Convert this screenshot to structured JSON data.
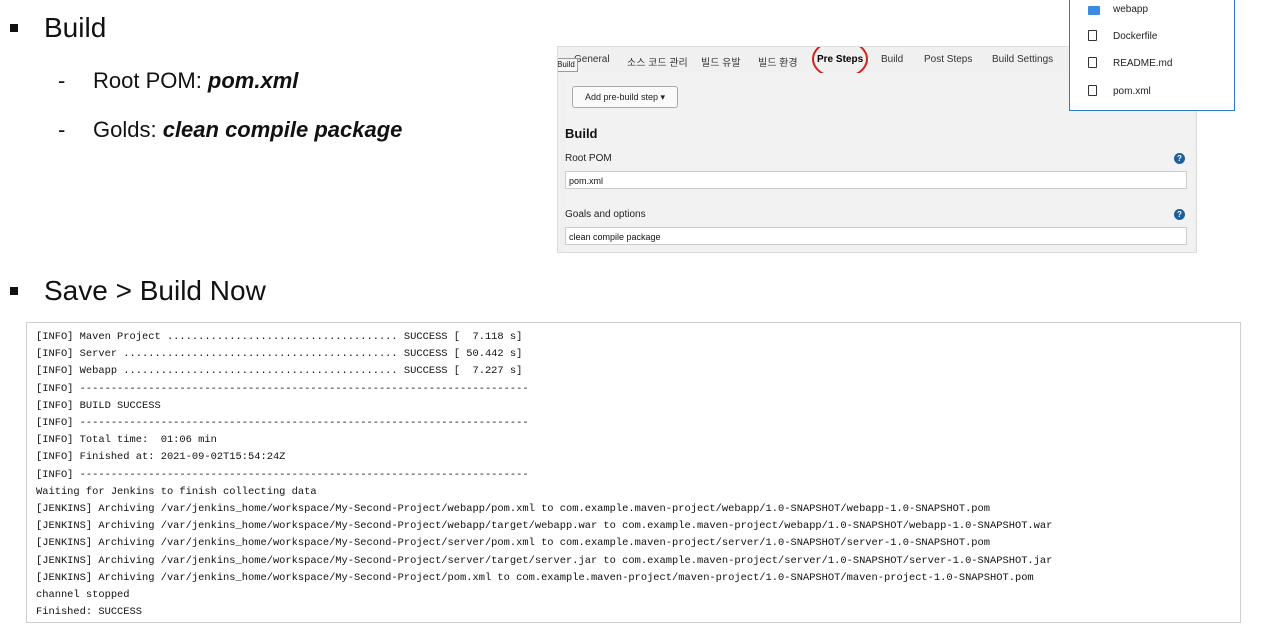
{
  "build": {
    "heading": "Build",
    "root_pom_label": "Root POM: ",
    "root_pom_value": "pom.xml",
    "goals_label": "Golds: ",
    "goals_value": "clean compile package"
  },
  "save_heading": "Save > Build Now",
  "config_panel": {
    "tabs": [
      "General",
      "소스 코드 관리",
      "빌드 유발",
      "빌드 환경",
      "Pre Steps",
      "Build",
      "Post Steps",
      "Build Settings"
    ],
    "active_tab": "Pre Steps",
    "tooltip": "Build",
    "add_step_button": "Add pre-build step ▾",
    "section_title": "Build",
    "root_pom_label": "Root POM",
    "root_pom_value": "pom.xml",
    "goals_label": "Goals and options",
    "goals_value": "clean compile package",
    "help_icon": "?"
  },
  "file_browser": {
    "items": [
      {
        "name": "webapp",
        "type": "folder"
      },
      {
        "name": "Dockerfile",
        "type": "file"
      },
      {
        "name": "README.md",
        "type": "file"
      },
      {
        "name": "pom.xml",
        "type": "file"
      }
    ]
  },
  "console": {
    "lines": [
      "[INFO] Maven Project ..................................... SUCCESS [  7.118 s]",
      "[INFO] Server ............................................ SUCCESS [ 50.442 s]",
      "[INFO] Webapp ............................................ SUCCESS [  7.227 s]",
      "[INFO] ------------------------------------------------------------------------",
      "[INFO] BUILD SUCCESS",
      "[INFO] ------------------------------------------------------------------------",
      "[INFO] Total time:  01:06 min",
      "[INFO] Finished at: 2021-09-02T15:54:24Z",
      "[INFO] ------------------------------------------------------------------------",
      "Waiting for Jenkins to finish collecting data",
      "[JENKINS] Archiving /var/jenkins_home/workspace/My-Second-Project/webapp/pom.xml to com.example.maven-project/webapp/1.0-SNAPSHOT/webapp-1.0-SNAPSHOT.pom",
      "[JENKINS] Archiving /var/jenkins_home/workspace/My-Second-Project/webapp/target/webapp.war to com.example.maven-project/webapp/1.0-SNAPSHOT/webapp-1.0-SNAPSHOT.war",
      "[JENKINS] Archiving /var/jenkins_home/workspace/My-Second-Project/server/pom.xml to com.example.maven-project/server/1.0-SNAPSHOT/server-1.0-SNAPSHOT.pom",
      "[JENKINS] Archiving /var/jenkins_home/workspace/My-Second-Project/server/target/server.jar to com.example.maven-project/server/1.0-SNAPSHOT/server-1.0-SNAPSHOT.jar",
      "[JENKINS] Archiving /var/jenkins_home/workspace/My-Second-Project/pom.xml to com.example.maven-project/maven-project/1.0-SNAPSHOT/maven-project-1.0-SNAPSHOT.pom",
      "channel stopped",
      "Finished: SUCCESS"
    ]
  },
  "colors": {
    "highlight_circle": "#d62020",
    "help_icon": "#1d5f9e",
    "folder_icon": "#3d8be0",
    "file_browser_border": "#2d7bd0"
  }
}
